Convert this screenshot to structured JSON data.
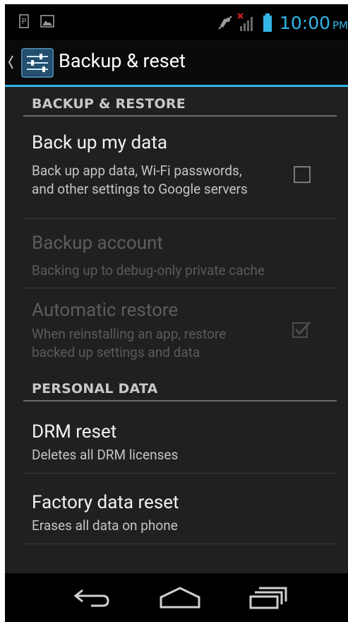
{
  "status_bar": {
    "time": "10:00",
    "ampm": "PM",
    "accent": "#33b5e5",
    "icons": [
      "parking-notification-icon",
      "image-notification-icon",
      "mute-icon",
      "signal-no-service-icon",
      "battery-icon"
    ]
  },
  "action_bar": {
    "title": "Backup & reset",
    "icons": [
      "up-caret-icon",
      "settings-app-icon"
    ]
  },
  "sections": [
    {
      "header": "BACKUP & RESTORE",
      "items": [
        {
          "title": "Back up my data",
          "summary": "Back up app data, Wi-Fi passwords, and other settings to Google servers",
          "checkbox": "unchecked",
          "enabled": true
        },
        {
          "title": "Backup account",
          "summary": "Backing up to debug-only private cache",
          "enabled": false
        },
        {
          "title": "Automatic restore",
          "summary": "When reinstalling an app, restore backed up settings and data",
          "checkbox": "checked",
          "enabled": false
        }
      ]
    },
    {
      "header": "PERSONAL DATA",
      "items": [
        {
          "title": "DRM reset",
          "summary": "Deletes all DRM licenses",
          "enabled": true
        },
        {
          "title": "Factory data reset",
          "summary": "Erases all data on phone",
          "enabled": true
        }
      ]
    }
  ],
  "nav_bar": {
    "buttons": [
      "back-icon",
      "home-icon",
      "recent-apps-icon"
    ]
  }
}
